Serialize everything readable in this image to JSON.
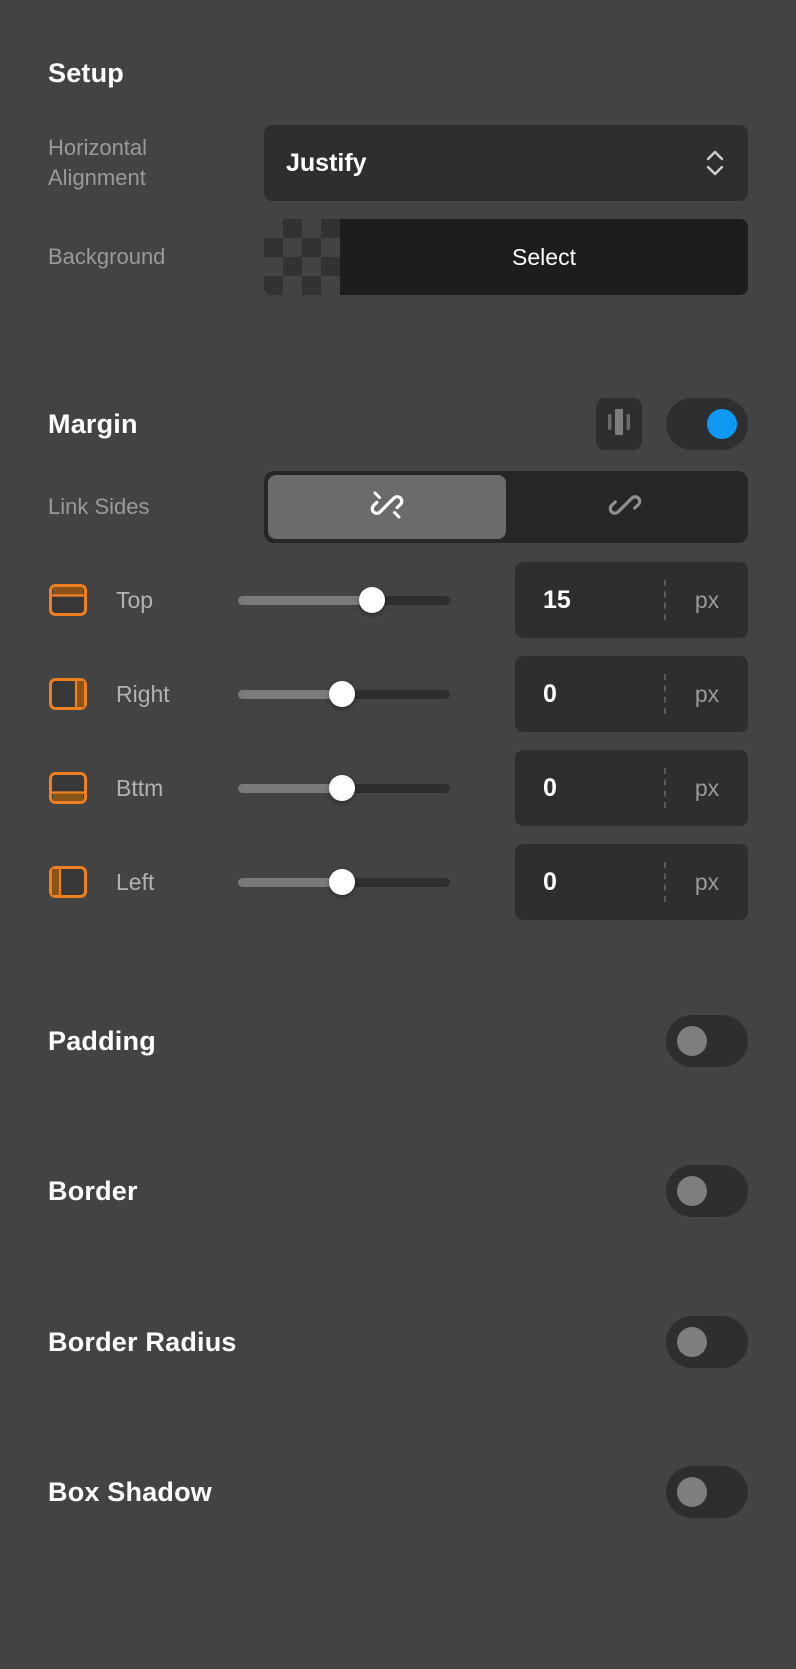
{
  "setup": {
    "title": "Setup",
    "horizontal_alignment": {
      "label": "Horizontal Alignment",
      "value": "Justify",
      "stepper_icon": "chevron-updown-icon"
    },
    "background": {
      "label": "Background",
      "swatch": "transparent-checkerboard",
      "button_label": "Select"
    }
  },
  "margin": {
    "title": "Margin",
    "visibility_icon": "margin-spacing-icon",
    "enabled": true,
    "link_sides": {
      "label": "Link Sides",
      "selected": "unlinked",
      "options": [
        {
          "id": "unlinked",
          "icon": "link-broken-icon"
        },
        {
          "id": "linked",
          "icon": "link-icon"
        }
      ]
    },
    "sides": [
      {
        "name": "Top",
        "icon": "box-top-icon",
        "value": "15",
        "unit": "px",
        "slider_pct": 63
      },
      {
        "name": "Right",
        "icon": "box-right-icon",
        "value": "0",
        "unit": "px",
        "slider_pct": 49
      },
      {
        "name": "Bttm",
        "icon": "box-bottom-icon",
        "value": "0",
        "unit": "px",
        "slider_pct": 49
      },
      {
        "name": "Left",
        "icon": "box-left-icon",
        "value": "0",
        "unit": "px",
        "slider_pct": 49
      }
    ]
  },
  "sections": [
    {
      "title": "Padding",
      "enabled": false
    },
    {
      "title": "Border",
      "enabled": false
    },
    {
      "title": "Border Radius",
      "enabled": false
    },
    {
      "title": "Box Shadow",
      "enabled": false
    }
  ],
  "colors": {
    "panel_bg": "#434343",
    "control_bg": "#2e2e2e",
    "dark_bg": "#1d1d1d",
    "accent_on": "#0d99f2",
    "accent_orange": "#ef8022",
    "knob_off": "#7e7e7e",
    "text_primary": "#ffffff",
    "text_muted": "#9a9a9a"
  }
}
